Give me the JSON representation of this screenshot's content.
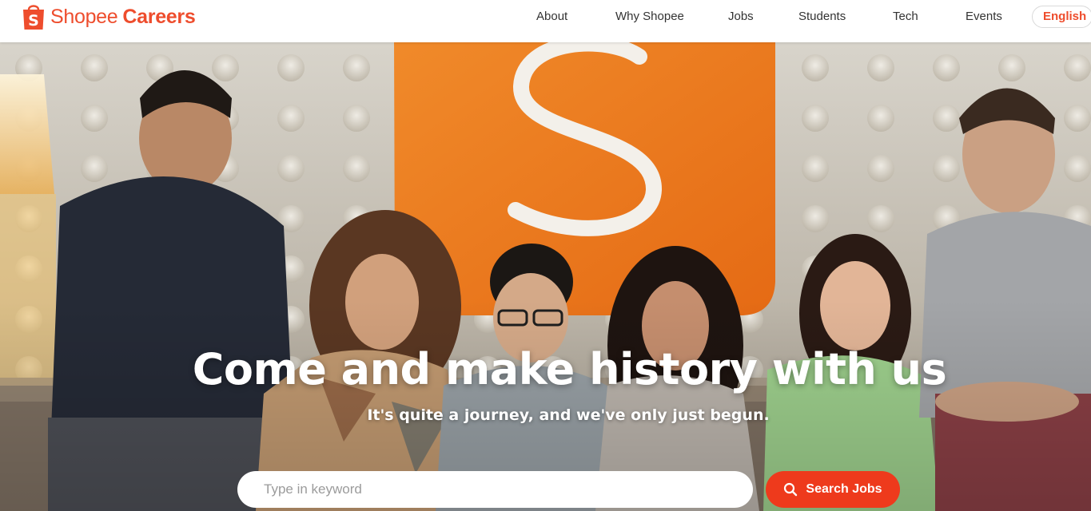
{
  "brand": {
    "name": "Shopee",
    "suffix": "Careers",
    "bag_letter": "S",
    "color": "#ee4d2d"
  },
  "nav": {
    "items": [
      {
        "label": "About"
      },
      {
        "label": "Why Shopee"
      },
      {
        "label": "Jobs"
      },
      {
        "label": "Students"
      },
      {
        "label": "Tech"
      },
      {
        "label": "Events"
      }
    ],
    "language": "English"
  },
  "hero": {
    "title": "Come and make history with us",
    "subtitle": "It's quite a journey, and we've only just begun.",
    "background_icon": "team-photo-with-shopee-logo"
  },
  "search": {
    "placeholder": "Type in keyword",
    "value": "",
    "button_label": "Search Jobs",
    "button_icon": "search-icon",
    "button_color": "#ee3a1c"
  }
}
